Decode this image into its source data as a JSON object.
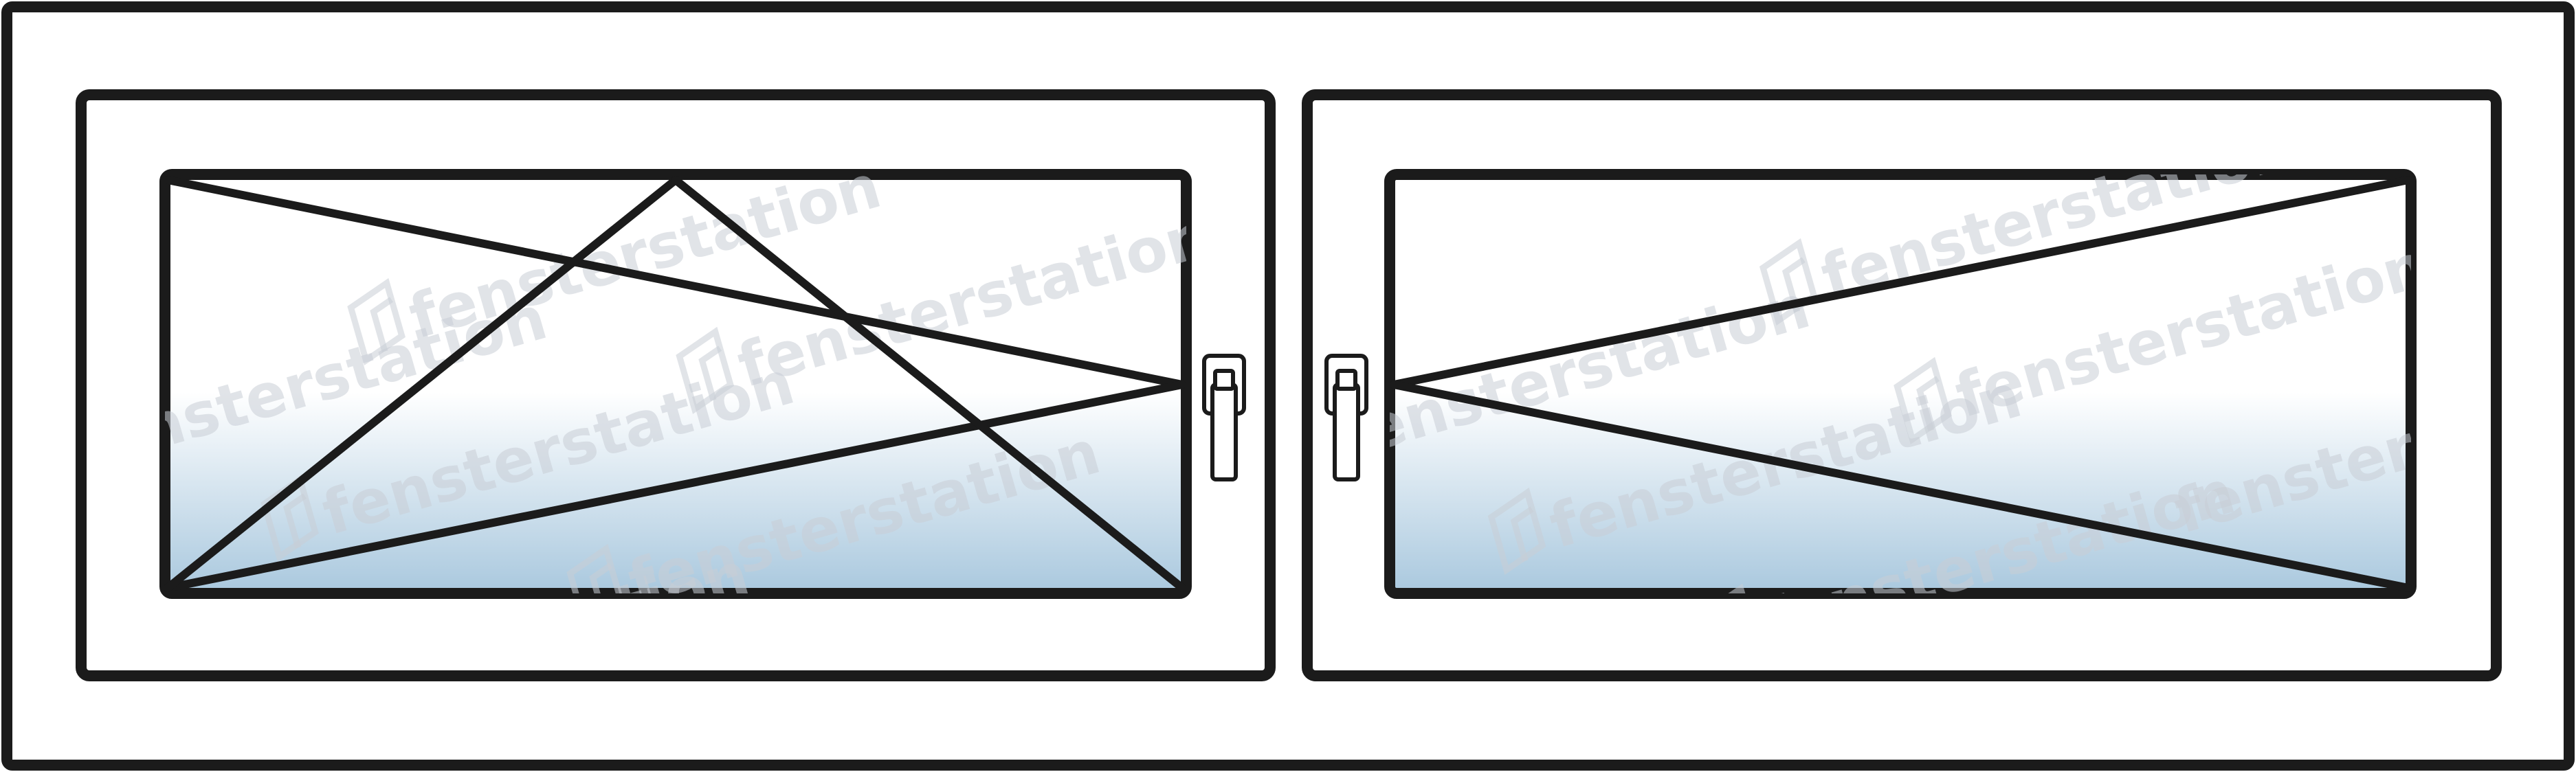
{
  "watermark": {
    "text": "fensterstation",
    "color": "#c9ced6"
  },
  "colors": {
    "frame_stroke": "#1b1b1b",
    "frame_fill": "#ffffff",
    "glass_top": "#ffffff",
    "glass_bottom": "#a9c8de"
  },
  "window": {
    "type": "two-sash window",
    "sashes": [
      {
        "id": "left",
        "opening": "tilt-and-turn",
        "hinge_side": "left",
        "handle_side": "right"
      },
      {
        "id": "right",
        "opening": "turn",
        "hinge_side": "right",
        "handle_side": "left"
      }
    ]
  }
}
